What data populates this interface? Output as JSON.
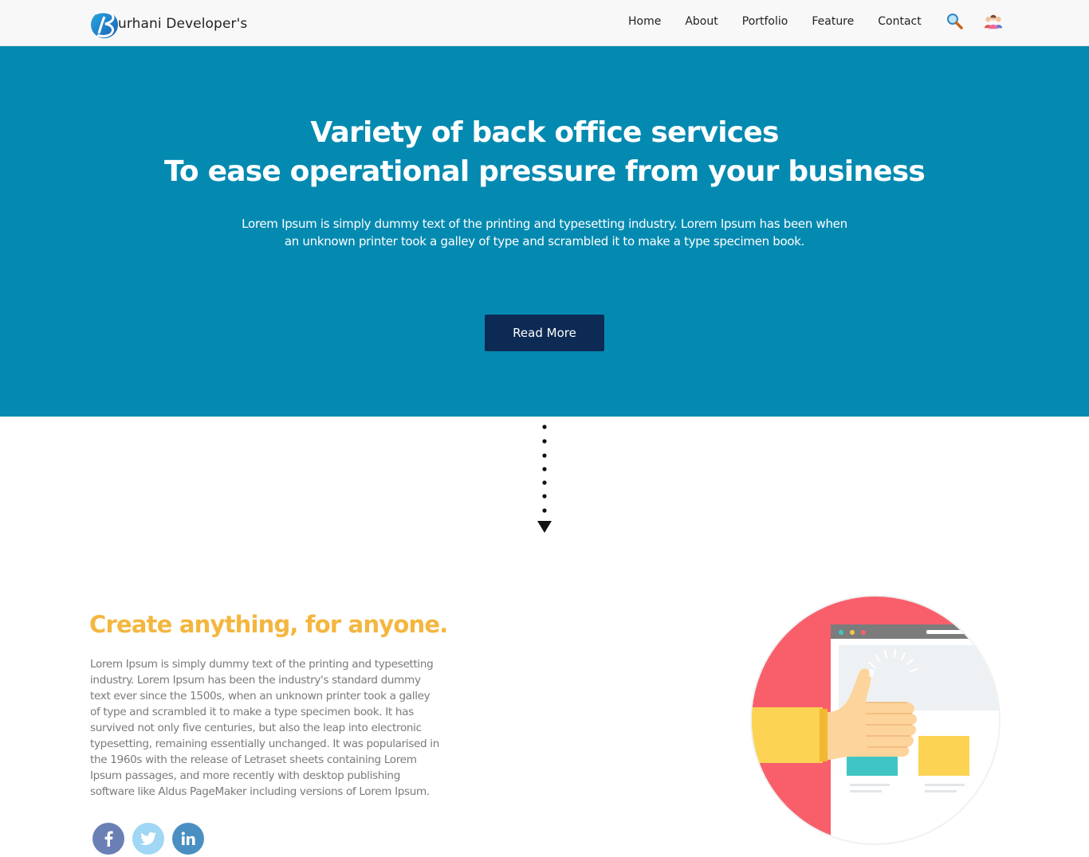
{
  "brand": {
    "name": "urhani Developer's",
    "logo_letter": "B"
  },
  "nav": {
    "items": [
      {
        "label": "Home"
      },
      {
        "label": "About"
      },
      {
        "label": "Portfolio"
      },
      {
        "label": "Feature"
      },
      {
        "label": "Contact"
      }
    ],
    "search_icon": "search-icon",
    "users_icon": "users-icon"
  },
  "hero": {
    "title_line1": "Variety of back office services",
    "title_line2": "To ease operational pressure from your business",
    "text": "Lorem Ipsum is simply dummy text of the printing and typesetting industry. Lorem Ipsum has been when an unknown printer took a galley of type and scrambled it to make a type specimen book.",
    "button_label": "Read More",
    "bg_color": "#048ab1",
    "button_color": "#0c2a54"
  },
  "feature": {
    "title": "Create anything, for anyone.",
    "text": "Lorem Ipsum is simply dummy text of the printing and typesetting industry. Lorem Ipsum has been the industry's standard dummy text ever since the 1500s, when an unknown printer took a galley of type and scrambled it to make a type specimen book. It has survived not only five centuries, but also the leap into electronic typesetting, remaining essentially unchanged. It was popularised in the 1960s with the release of Letraset sheets containing Lorem Ipsum passages, and more recently with desktop publishing software like Aldus PageMaker including versions of Lorem Ipsum.",
    "title_color": "#f4b63f"
  },
  "social": [
    {
      "name": "facebook-icon",
      "glyph": "f"
    },
    {
      "name": "twitter-icon",
      "glyph": "🐦"
    },
    {
      "name": "linkedin-icon",
      "glyph": "in"
    }
  ]
}
